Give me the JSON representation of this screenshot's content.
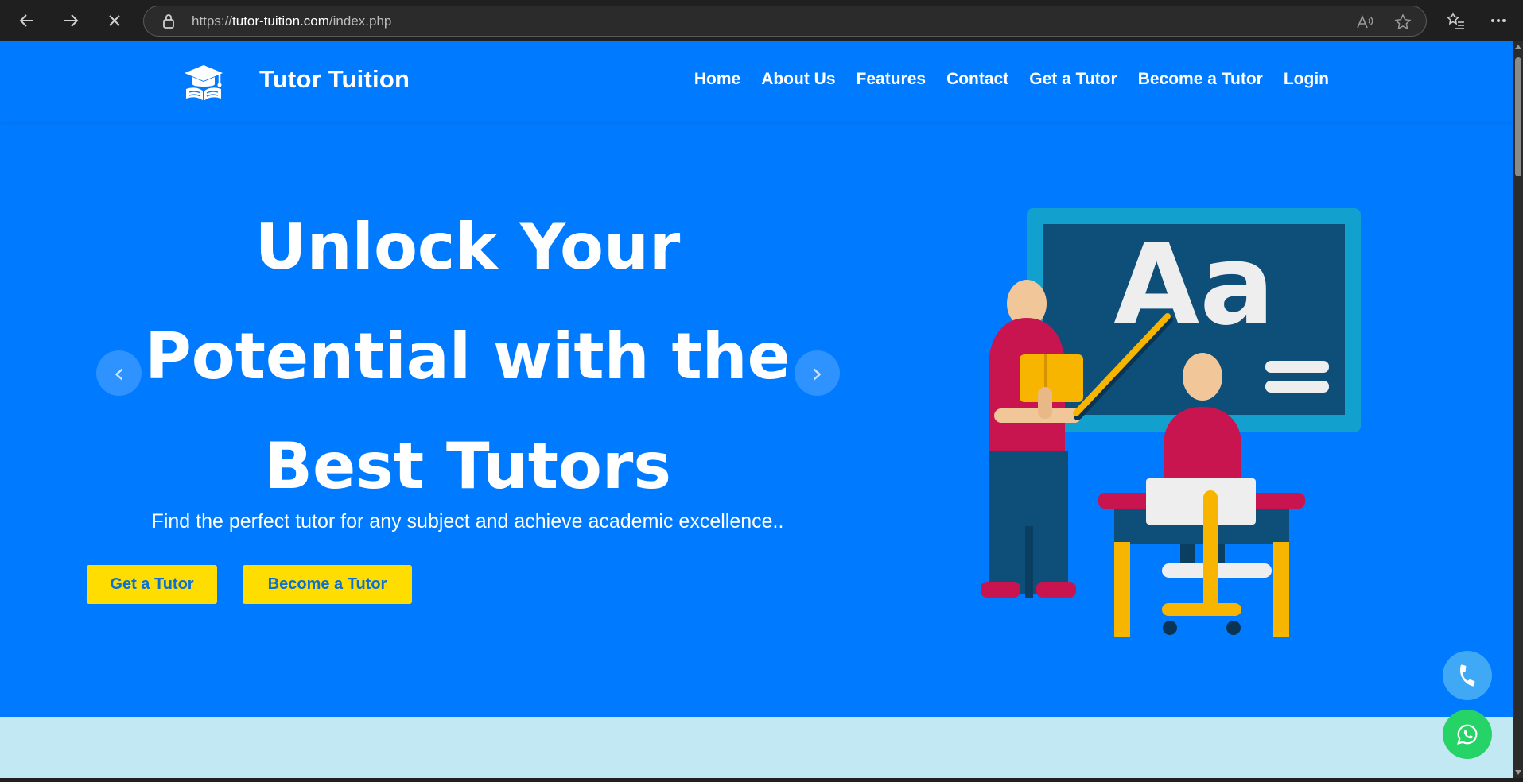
{
  "browser": {
    "url_prefix": "https://",
    "url_host": "tutor-tuition.com",
    "url_path": "/index.php",
    "back_icon": "arrow-left-icon",
    "forward_icon": "arrow-right-icon",
    "stop_icon": "close-icon"
  },
  "site": {
    "brand_name": "Tutor Tuition",
    "nav": [
      "Home",
      "About Us",
      "Features",
      "Contact",
      "Get a Tutor",
      "Become a Tutor",
      "Login"
    ]
  },
  "hero": {
    "title_line1": "Unlock Your",
    "title_line2": "Potential with the",
    "title_line3": "Best Tutors",
    "subtitle": "Find the perfect tutor for any subject and achieve academic excellence..",
    "primary_button": "Get a Tutor",
    "secondary_button": "Become a Tutor",
    "prev_symbol": "‹",
    "next_symbol": "›",
    "board_text": "Aa"
  },
  "colors": {
    "page_bg": "#007bff",
    "button_bg": "#ffdd00",
    "button_text": "#0a6fd6",
    "lower_band": "#c2e8f3",
    "phone_fab": "#3fa9f5",
    "whatsapp_fab": "#25d366"
  }
}
